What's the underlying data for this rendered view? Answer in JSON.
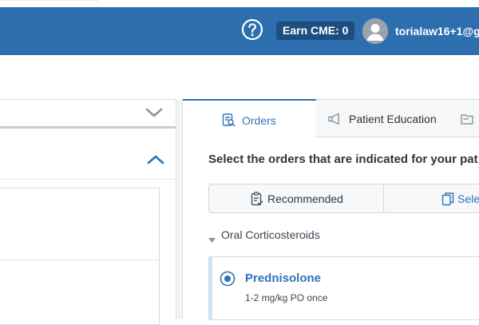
{
  "header": {
    "cme_badge": "Earn CME: 0",
    "user_name": "torialaw16+1@gm",
    "icons": {
      "help": "help-circle-icon",
      "avatar": "user-avatar-icon"
    }
  },
  "left_pane": {
    "icons": {
      "collapse": "chevron-down-icon",
      "expand": "chevron-up-icon"
    }
  },
  "tabs": [
    {
      "label": "Orders",
      "icon": "orders-checklist-icon",
      "active": true
    },
    {
      "label": "Patient Education",
      "icon": "megaphone-icon",
      "active": false
    },
    {
      "label": "",
      "icon": "folder-icon",
      "active": false
    }
  ],
  "orders": {
    "prompt": "Select the orders that are indicated for your pat",
    "toggles": {
      "recommended": "Recommended",
      "select": "Sele"
    },
    "group": {
      "label": "Oral Corticosteroids",
      "items": [
        {
          "name": "Prednisolone",
          "dose": "1-2 mg/kg PO once",
          "selected": true
        }
      ]
    }
  },
  "colors": {
    "header_bg": "#2d6fae",
    "accent": "#2d74b7",
    "badge_bg": "#1c4e80"
  }
}
